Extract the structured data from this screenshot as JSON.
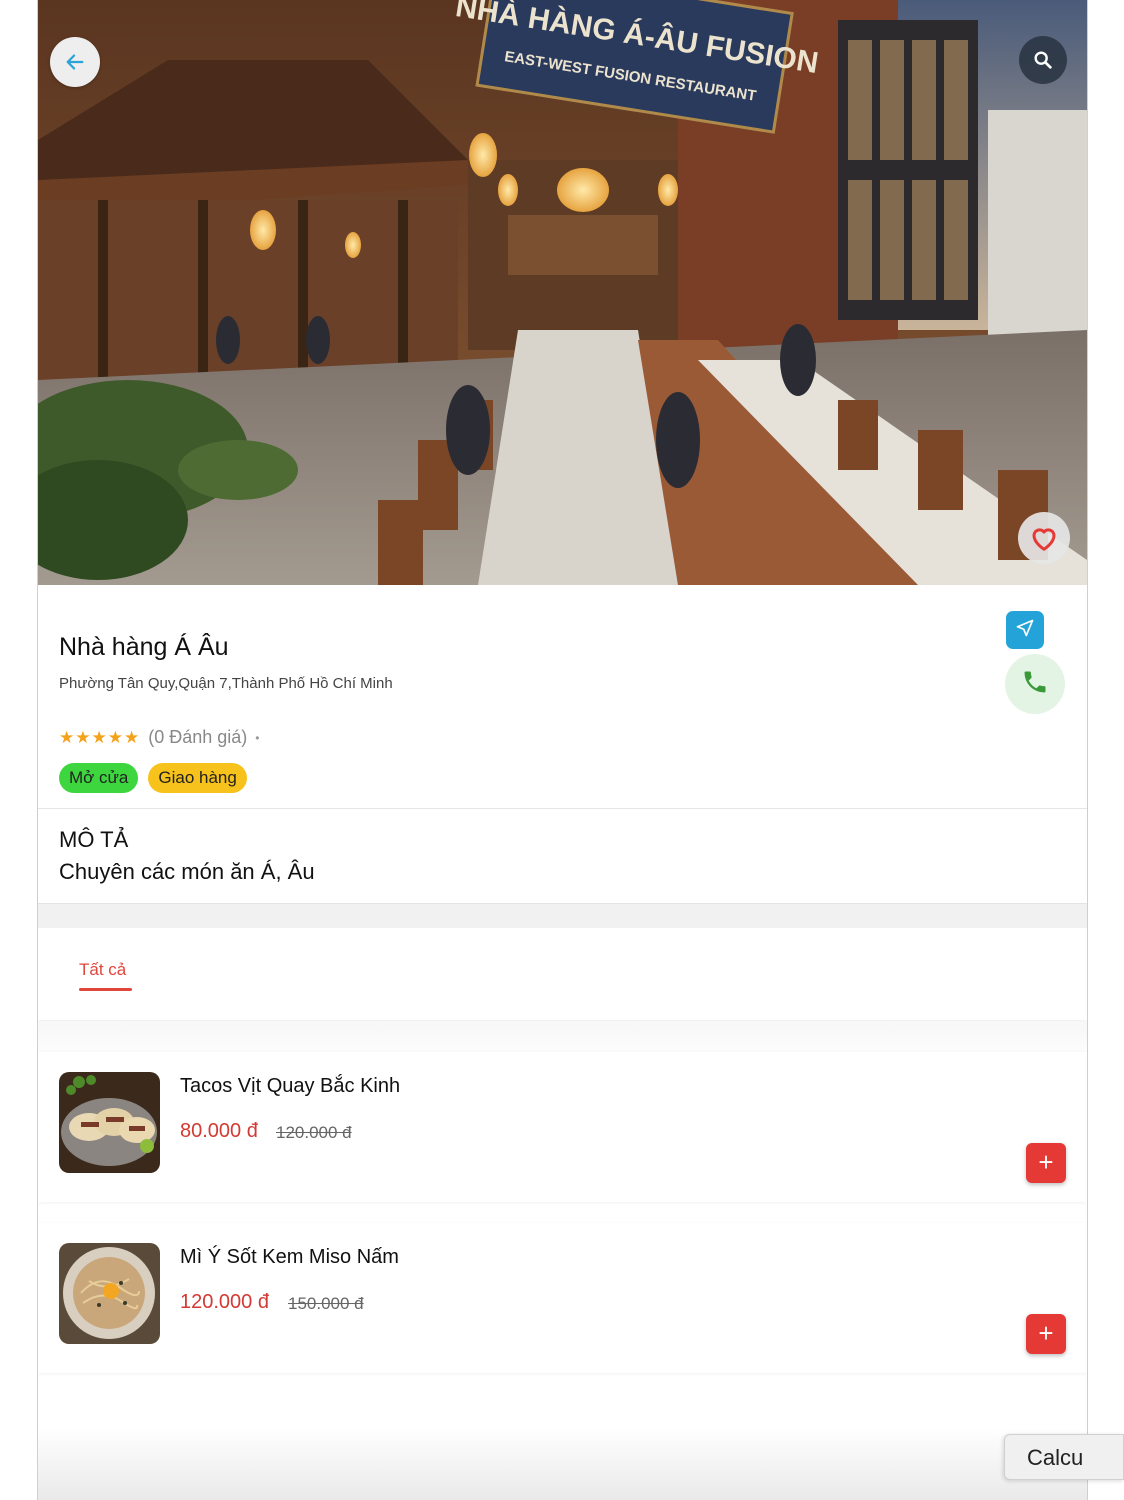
{
  "hero": {
    "sign_main": "NHÀ HÀNG Á-ÂU FUSION",
    "sign_sub": "EAST-WEST FUSION RESTAURANT"
  },
  "restaurant": {
    "name": "Nhà hàng Á Âu",
    "address": "Phường Tân Quy,Quận 7,Thành Phố Hồ Chí Minh",
    "stars": "★★★★★",
    "rating_count": "(0 Đánh giá)",
    "separator": "•",
    "badges": {
      "open": "Mở cửa",
      "delivery": "Giao hàng"
    }
  },
  "description": {
    "heading": "MÔ TẢ",
    "text": "Chuyên các món ăn Á, Âu"
  },
  "tabs": [
    {
      "label": "Tất cả",
      "active": true
    }
  ],
  "menu_items": [
    {
      "name": "Tacos Vịt Quay Bắc Kinh",
      "price": "80.000  đ",
      "old_price": "120.000  đ",
      "add_label": "+"
    },
    {
      "name": "Mì Ý Sốt Kem Miso Nấm",
      "price": "120.000  đ",
      "old_price": "150.000  đ",
      "add_label": "+"
    }
  ],
  "floating": {
    "calc_label": "Calcu"
  },
  "icons": {
    "back": "arrow-left-icon",
    "search": "search-icon",
    "favorite": "heart-icon",
    "navigate": "navigation-arrow-icon",
    "phone": "phone-icon"
  },
  "colors": {
    "accent_red": "#e53935",
    "price_red": "#d23a33",
    "tab_red": "#e0463b",
    "open_green": "#3ed63e",
    "delivery_yellow": "#f7c21b",
    "nav_blue": "#24a3d8",
    "star_orange": "#f4a21c",
    "phone_green": "#3a9a3a"
  }
}
